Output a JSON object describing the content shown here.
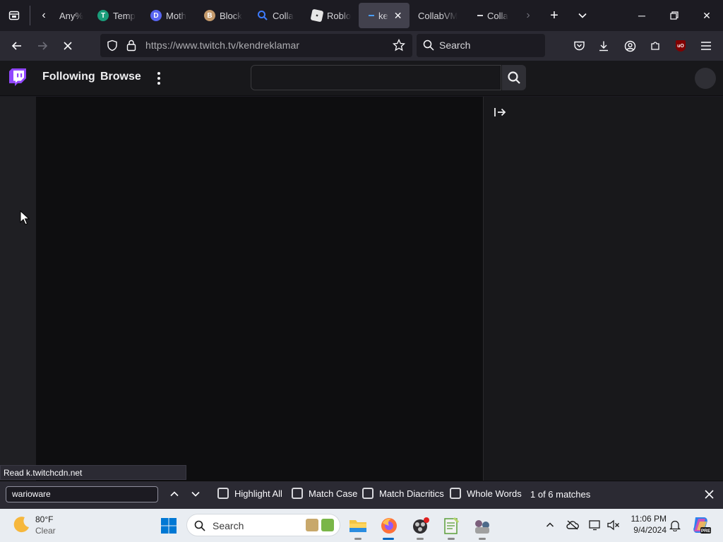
{
  "tabs": [
    {
      "title": "Any%",
      "favicon_color": "#2b2a33",
      "favicon_icon": ""
    },
    {
      "title": "Temp",
      "favicon_color": "#1a9c7a",
      "favicon_icon": "T"
    },
    {
      "title": "Moth",
      "favicon_color": "#5865f2",
      "favicon_icon": "D"
    },
    {
      "title": "Block",
      "favicon_color": "#c49a6c",
      "favicon_icon": "B"
    },
    {
      "title": "Colla",
      "favicon_color": "#3d5afe",
      "favicon_icon": "Q"
    },
    {
      "title": "Roblo",
      "favicon_color": "#e6e6e6",
      "favicon_icon": "R"
    },
    {
      "title": "ke",
      "favicon_color": "#6441a5",
      "favicon_icon": ""
    },
    {
      "title": "CollabVM",
      "favicon_color": "",
      "favicon_icon": ""
    },
    {
      "title": "Colla",
      "favicon_color": "#9147ff",
      "favicon_icon": ""
    }
  ],
  "url": "https://www.twitch.tv/kendreklamar",
  "search_placeholder": "Search",
  "twitch": {
    "following": "Following",
    "browse": "Browse",
    "brand_color": "#9147ff"
  },
  "status_tip": "Read k.twitchcdn.net",
  "findbar": {
    "query": "warioware",
    "highlight_all": "Highlight All",
    "match_case": "Match Case",
    "match_diacritics": "Match Diacritics",
    "whole_words": "Whole Words",
    "matches": "1 of 6 matches"
  },
  "taskbar": {
    "weather_temp": "80°F",
    "weather_desc": "Clear",
    "search": "Search",
    "time": "11:06 PM",
    "date": "9/4/2024"
  }
}
